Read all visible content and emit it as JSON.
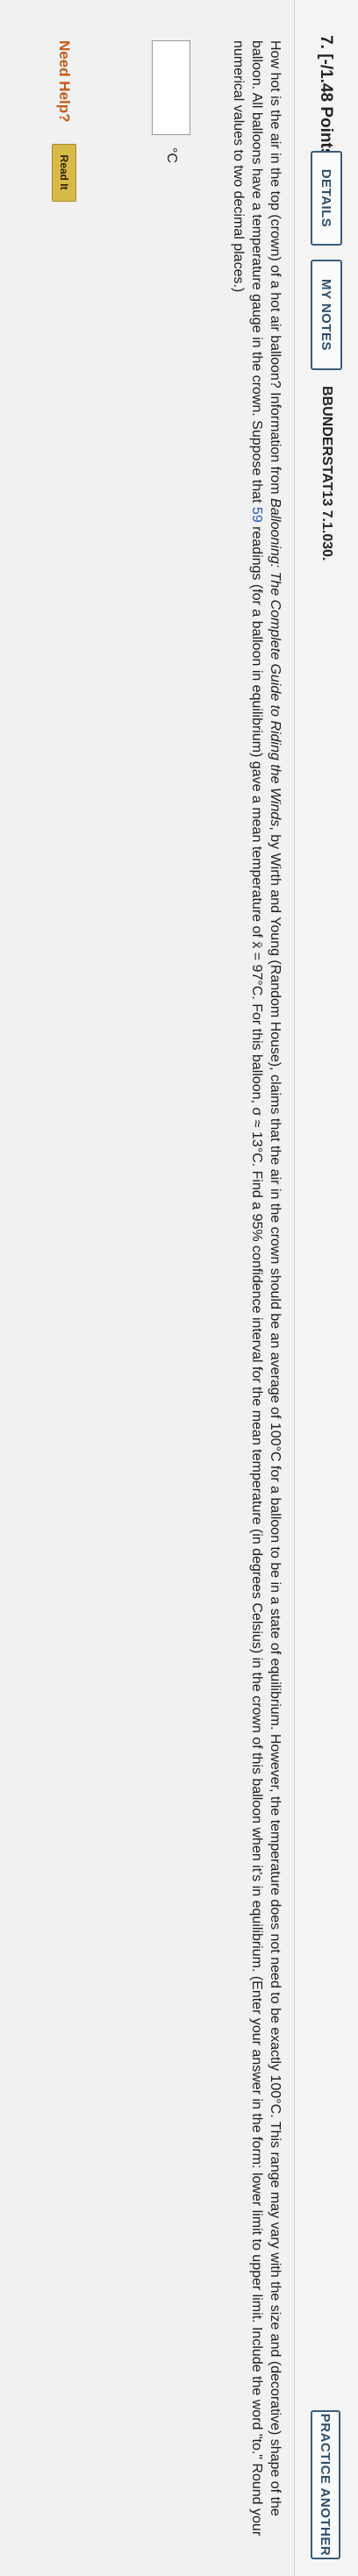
{
  "question": {
    "number_label": "7. [-/1.48 Points]",
    "details_label": "DETAILS",
    "my_notes_label": "MY NOTES",
    "problem_id": "BBUNDERSTAT13 7.1.030.",
    "practice_label": "PRACTICE ANOTHER"
  },
  "problem": {
    "text_1": "How hot is the air in the top (crown) of a hot air balloon? Information from ",
    "book_title": "Ballooning: The Complete Guide to Riding the Winds",
    "text_2": ", by Wirth and Young (Random House), claims that the air in the crown should be an average of 100°C for a balloon to be in a state of equilibrium. However, the temperature does not need to be exactly 100°C. This range may vary with the size and (decorative) shape of the balloon. All balloons have a temperature gauge in the crown. Suppose that ",
    "sample_size": "59",
    "text_3": " readings (for a balloon in equilibrium) gave a mean temperature of x̄ = 97°C. For this balloon, σ ≈ 13°C. Find a 95% confidence interval for the mean temperature (in degrees Celsius) in the crown of this balloon when it's in equilibrium. (Enter your answer in the form: lower limit to upper limit. Include the word \"to.\" Round your numerical values to two decimal places.)"
  },
  "answer": {
    "value": "",
    "unit": "°C"
  },
  "help": {
    "label": "Need Help?",
    "read_it_label": "Read It"
  }
}
